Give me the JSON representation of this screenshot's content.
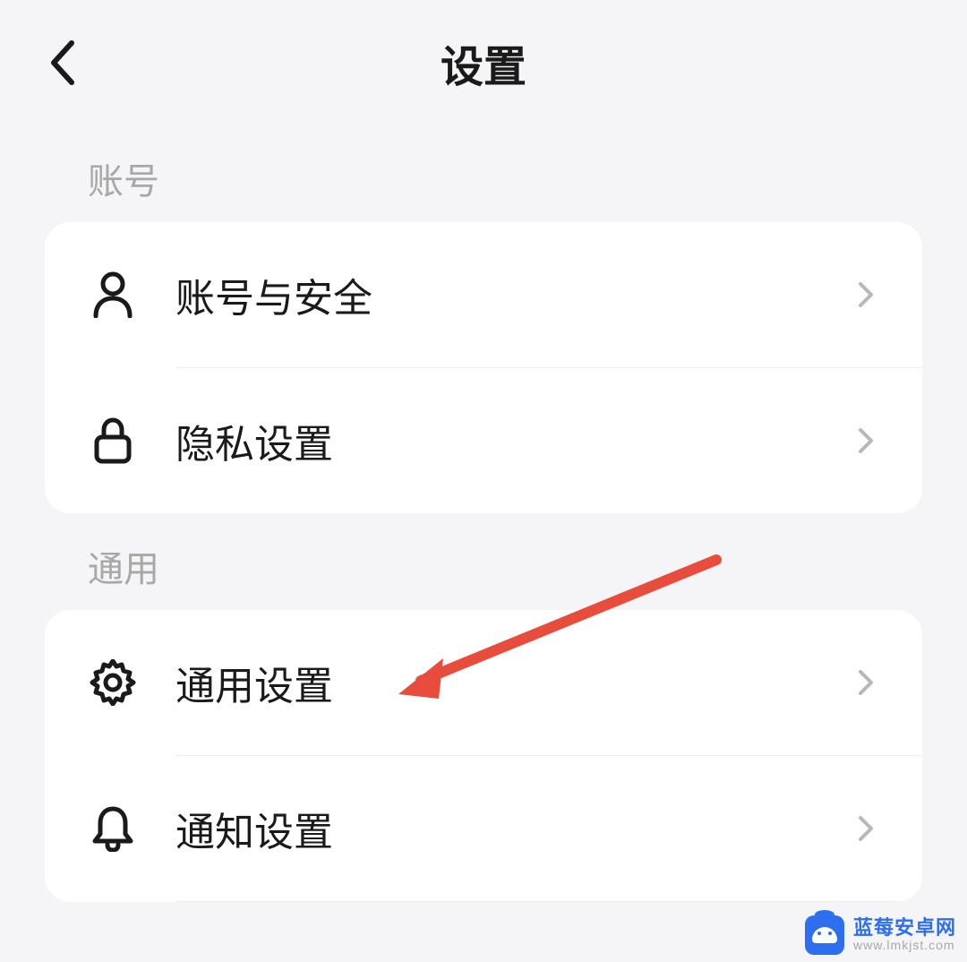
{
  "header": {
    "title": "设置"
  },
  "sections": [
    {
      "title": "账号",
      "items": [
        {
          "icon": "user",
          "label": "账号与安全"
        },
        {
          "icon": "lock",
          "label": "隐私设置"
        }
      ]
    },
    {
      "title": "通用",
      "items": [
        {
          "icon": "gear",
          "label": "通用设置"
        },
        {
          "icon": "bell",
          "label": "通知设置"
        }
      ]
    }
  ],
  "annotation": {
    "color": "#e74c3c",
    "target": "通用设置"
  },
  "watermark": {
    "title": "蓝莓安卓网",
    "url": "www.lmkjst.com"
  }
}
